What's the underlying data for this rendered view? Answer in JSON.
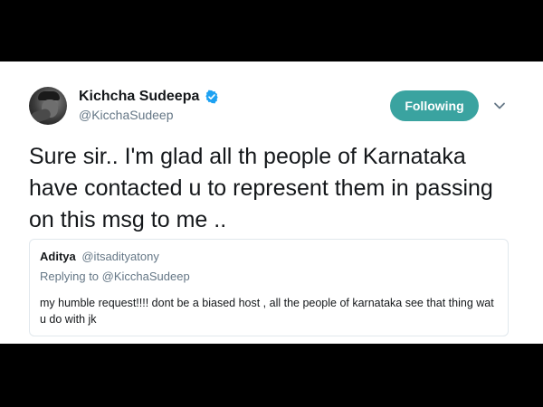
{
  "tweet": {
    "author": {
      "display_name": "Kichcha Sudeepa",
      "handle": "@KicchaSudeep",
      "verified": true
    },
    "follow_button_label": "Following",
    "text": "Sure sir.. I'm glad all th people of Karnataka have contacted u to represent them in passing on this msg to me ..",
    "quoted": {
      "author_name": "Aditya",
      "author_handle": "@itsadityatony",
      "replying_to_prefix": "Replying to",
      "replying_to_handle": "@KicchaSudeep",
      "text": "my humble request!!!! dont be a biased host , all the people of karnataka see that thing wat u do with jk"
    }
  },
  "colors": {
    "follow_button_bg": "#3aa3a0",
    "verified_badge": "#1da1f2",
    "secondary_text": "#657786",
    "primary_text": "#14171a",
    "background_frame": "#000000"
  },
  "icons": {
    "verified": "verified-badge-icon",
    "caret": "chevron-down-icon"
  }
}
